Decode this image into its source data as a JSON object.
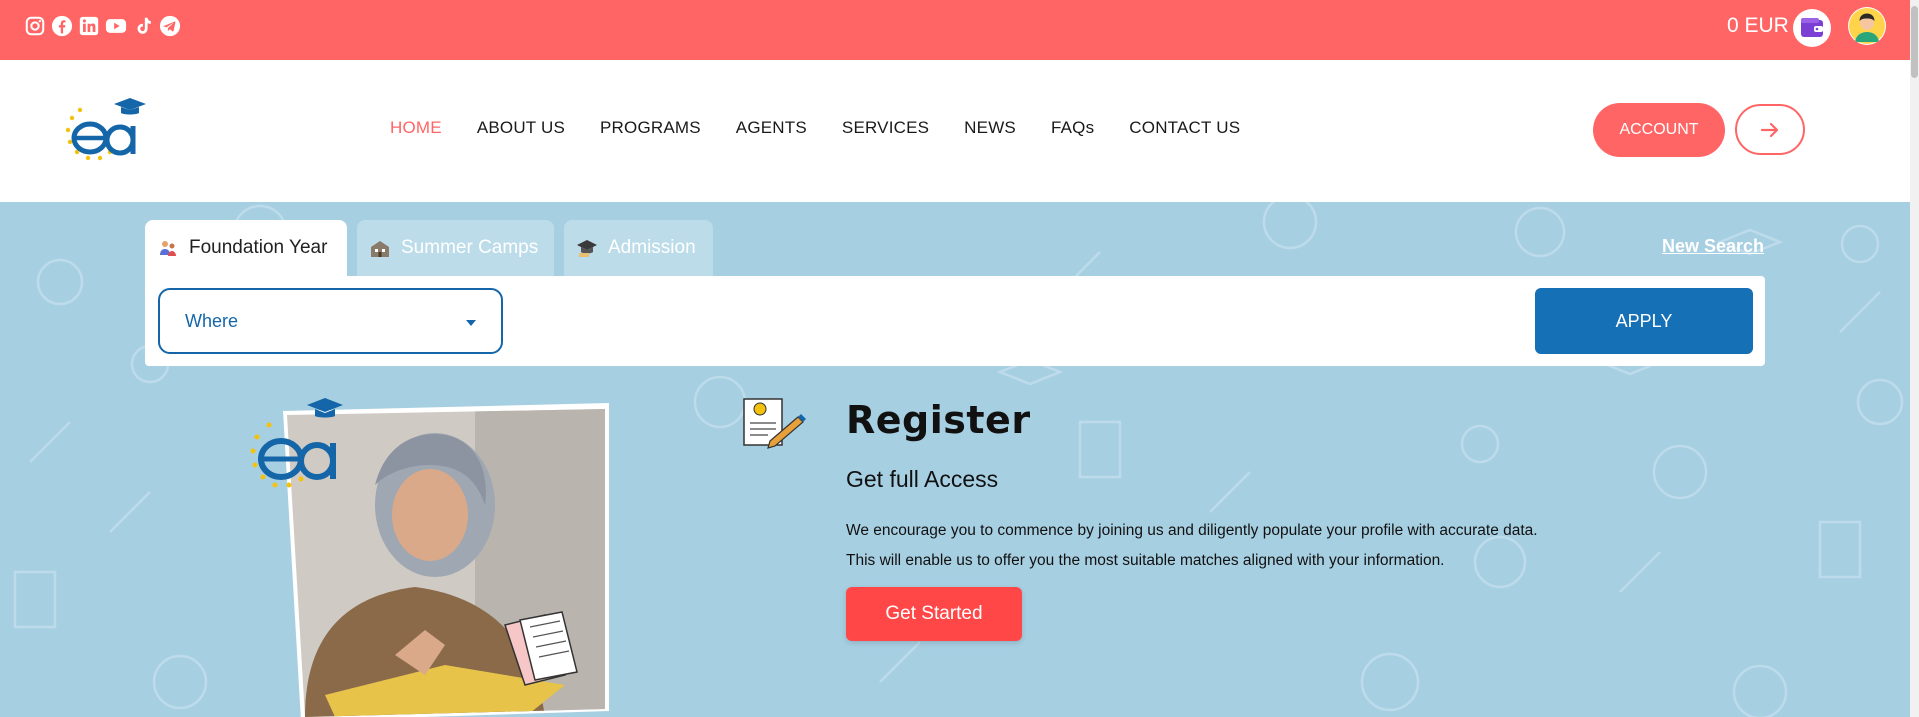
{
  "topbar": {
    "socials": [
      "instagram-icon",
      "facebook-icon",
      "linkedin-icon",
      "youtube-icon",
      "tiktok-icon",
      "telegram-icon"
    ],
    "wallet_amount": "0 EUR"
  },
  "nav": {
    "items": [
      {
        "label": "HOME",
        "active": true
      },
      {
        "label": "ABOUT US"
      },
      {
        "label": "PROGRAMS"
      },
      {
        "label": "AGENTS"
      },
      {
        "label": "SERVICES"
      },
      {
        "label": "NEWS"
      },
      {
        "label": "FAQs"
      },
      {
        "label": "CONTACT US"
      }
    ],
    "account_label": "ACCOUNT"
  },
  "search": {
    "tabs": [
      {
        "label": "Foundation Year",
        "active": true
      },
      {
        "label": "Summer Camps"
      },
      {
        "label": "Admission"
      }
    ],
    "new_search": "New Search",
    "where_label": "Where",
    "apply_label": "APPLY"
  },
  "register": {
    "title": "Register",
    "subtitle": "Get full Access",
    "text": "We encourage you to commence by joining us and diligently populate your profile with accurate data. This will enable us to offer you the most suitable matches aligned with your information.",
    "cta": "Get Started"
  },
  "colors": {
    "topbar": "#ff6565",
    "accent": "#ff6565",
    "primary_blue": "#1670b6",
    "hero_bg": "#a7cfe2",
    "cta": "#ff4747"
  }
}
